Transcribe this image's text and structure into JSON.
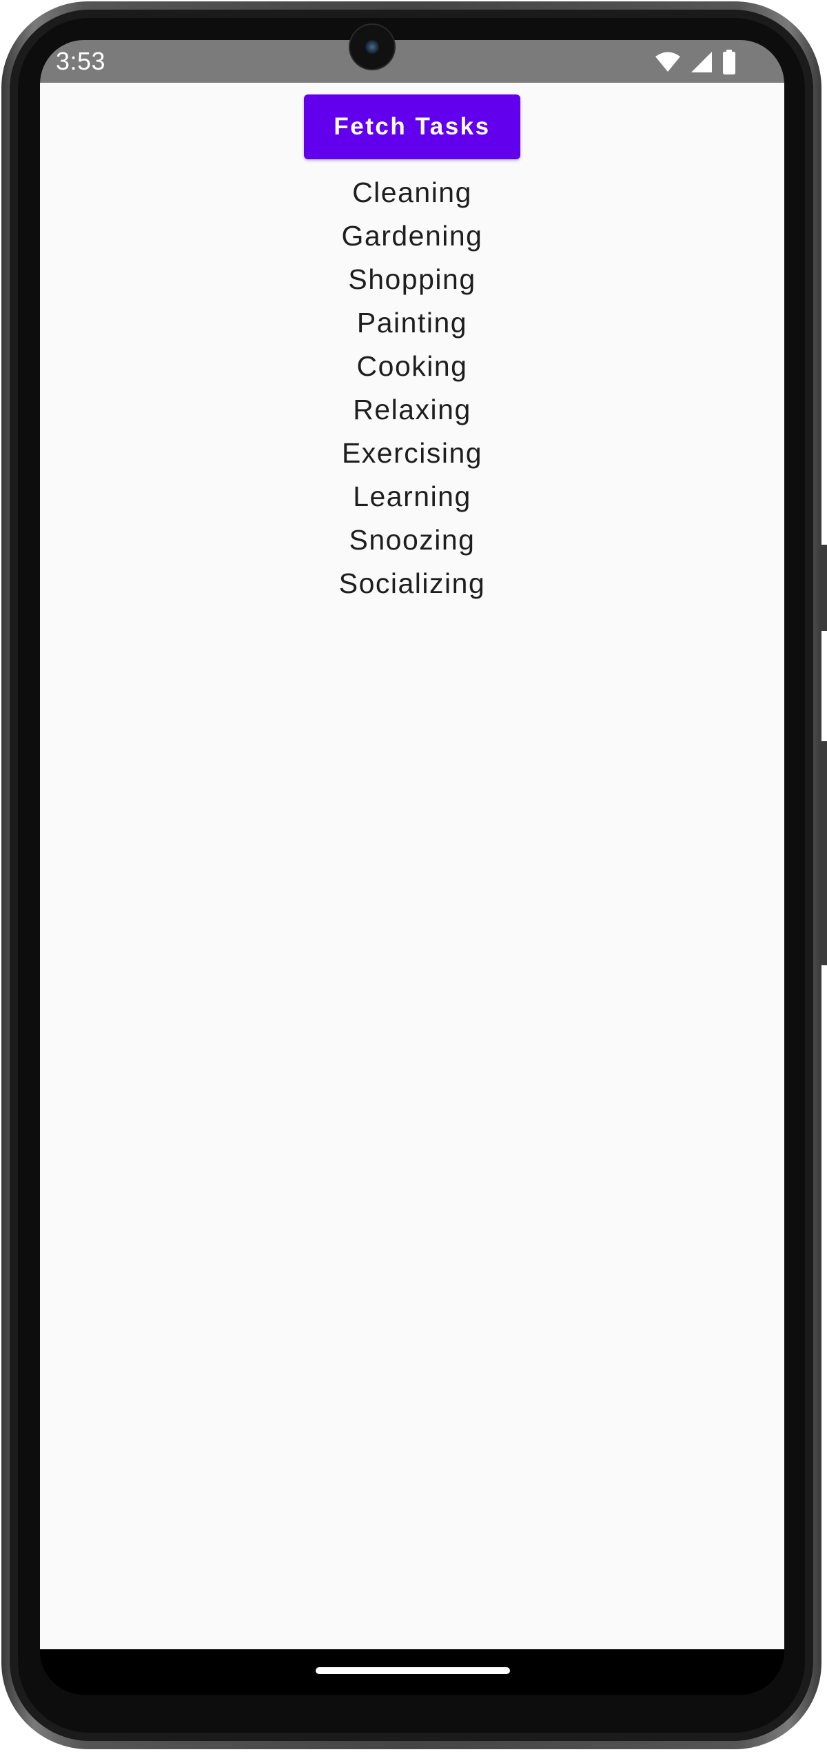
{
  "status_bar": {
    "time": "3:53",
    "icons": [
      "wifi-icon",
      "cell-signal-icon",
      "battery-icon"
    ]
  },
  "app": {
    "fetch_button_label": "Fetch Tasks",
    "tasks": [
      "Cleaning",
      "Gardening",
      "Shopping",
      "Painting",
      "Cooking",
      "Relaxing",
      "Exercising",
      "Learning",
      "Snoozing",
      "Socializing"
    ]
  },
  "colors": {
    "accent": "#6200ee",
    "status_bar": "#7b7b7b",
    "background": "#fafafa",
    "text": "#1e1e1e"
  }
}
